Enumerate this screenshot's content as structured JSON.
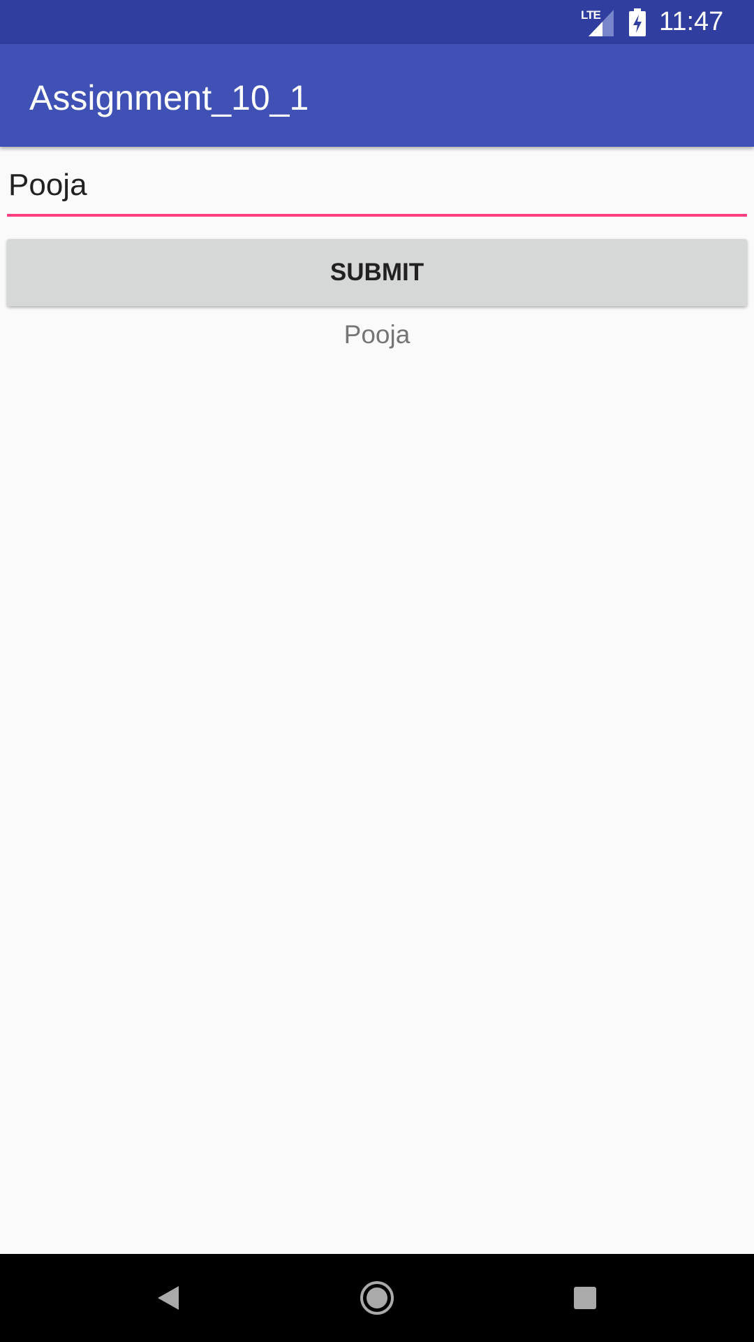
{
  "status_bar": {
    "network": "LTE",
    "time": "11:47"
  },
  "app_bar": {
    "title": "Assignment_10_1"
  },
  "form": {
    "name_value": "Pooja",
    "submit_label": "SUBMIT",
    "result_text": "Pooja"
  },
  "colors": {
    "primary": "#3f51b5",
    "primary_dark": "#303f9f",
    "accent": "#ff4081"
  }
}
